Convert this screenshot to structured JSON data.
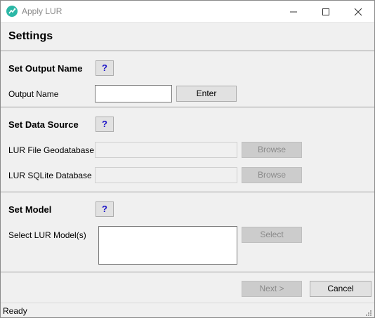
{
  "window": {
    "title": "Apply LUR",
    "icon": "app-logo-icon",
    "controls": [
      "minimize-icon",
      "maximize-icon",
      "close-icon"
    ]
  },
  "header": {
    "title": "Settings"
  },
  "sections": {
    "output": {
      "title": "Set Output Name",
      "help_label": "?",
      "name_label": "Output Name",
      "name_value": "",
      "enter_label": "Enter"
    },
    "source": {
      "title": "Set Data Source",
      "help_label": "?",
      "gdb_label": "LUR File Geodatabase",
      "gdb_value": "",
      "gdb_browse": "Browse",
      "sqlite_label": "LUR SQLite Database",
      "sqlite_value": "",
      "sqlite_browse": "Browse"
    },
    "model": {
      "title": "Set Model",
      "help_label": "?",
      "select_label": "Select LUR Model(s)",
      "select_button": "Select"
    }
  },
  "footer": {
    "next_label": "Next >",
    "cancel_label": "Cancel"
  },
  "status": {
    "text": "Ready"
  },
  "colors": {
    "accent_help": "#1a12c8",
    "app_icon": "#2bb7a6",
    "disabled_button": "#cccccc"
  }
}
